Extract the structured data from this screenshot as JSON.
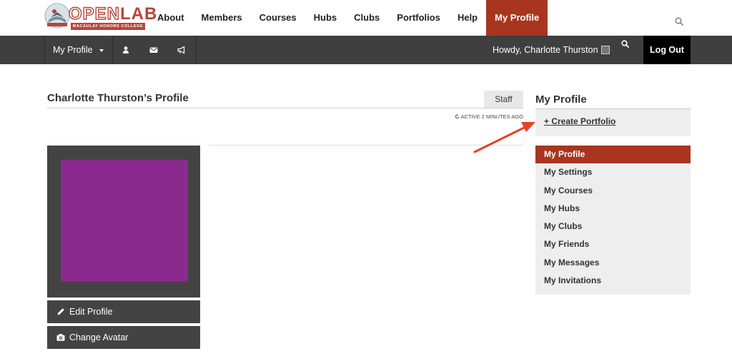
{
  "logo": {
    "word_open": "OPEN",
    "word_lab": "LAB",
    "subtitle": "MACAULAY HONORS COLLEGE",
    "brand_color": "#b5463a"
  },
  "main_menu": [
    {
      "label": "About"
    },
    {
      "label": "Members"
    },
    {
      "label": "Courses"
    },
    {
      "label": "Hubs"
    },
    {
      "label": "Clubs"
    },
    {
      "label": "Portfolios"
    },
    {
      "label": "Help"
    },
    {
      "label": "My Profile",
      "active": true
    }
  ],
  "top_search_icon": "search-icon",
  "admin_bar": {
    "my_profile_label": "My Profile",
    "icons": [
      "user-icon",
      "envelope-icon",
      "bullhorn-icon"
    ],
    "howdy_text": "Howdy, Charlotte Thurston",
    "search_icon": "search-icon",
    "logout_label": "Log Out"
  },
  "profile": {
    "title": "Charlotte Thurston’s Profile",
    "role_badge": "Staff",
    "last_active": "ACTIVE 2 MINUTES AGO",
    "avatar_color": "#8b2a8e",
    "edit_profile_label": "Edit Profile",
    "change_avatar_label": "Change Avatar"
  },
  "sidebar": {
    "title": "My Profile",
    "create_portfolio_label": "+ Create Portfolio",
    "items": [
      {
        "label": "My Profile",
        "active": true
      },
      {
        "label": "My Settings"
      },
      {
        "label": "My Courses"
      },
      {
        "label": "My Hubs"
      },
      {
        "label": "My Clubs"
      },
      {
        "label": "My Friends"
      },
      {
        "label": "My Messages"
      },
      {
        "label": "My Invitations"
      }
    ]
  },
  "colors": {
    "accent": "#a83520",
    "admin_bar": "#3f3f3f",
    "annotation_arrow": "#e8402a"
  }
}
